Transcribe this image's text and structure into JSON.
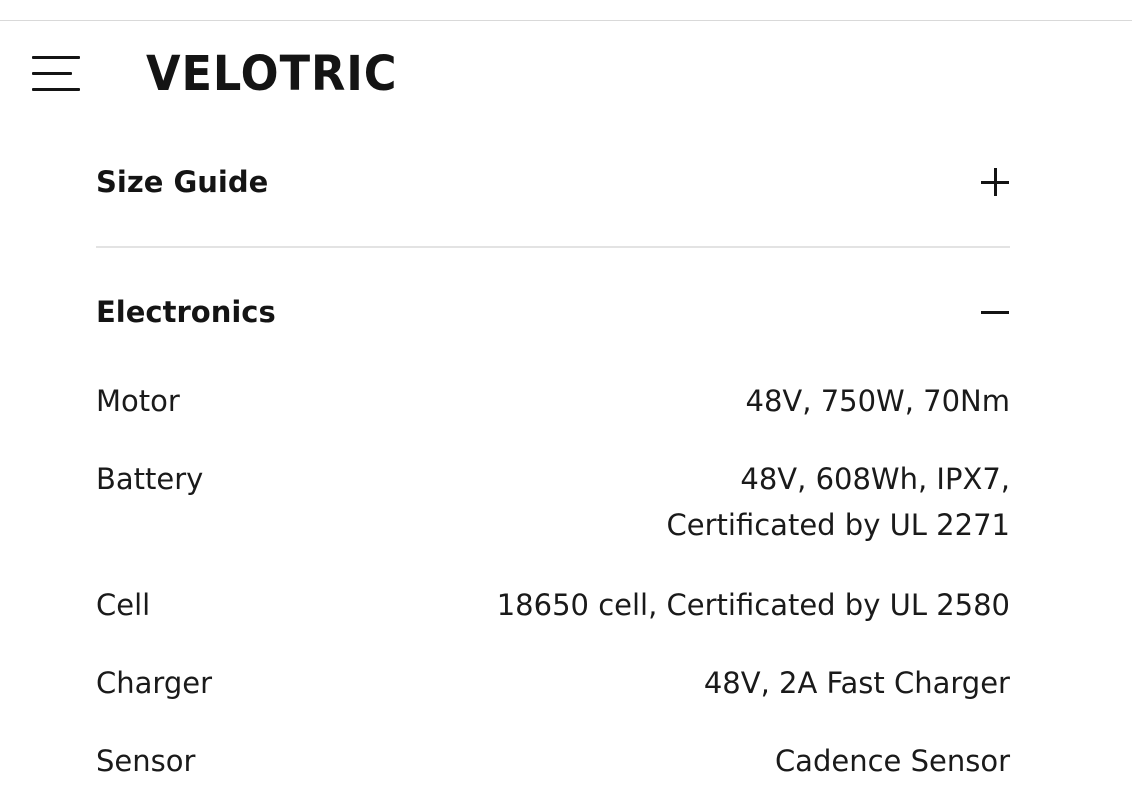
{
  "header": {
    "brand": "VELOTRIC",
    "menu_icon": "hamburger-menu-icon"
  },
  "accordion": [
    {
      "title": "Size Guide",
      "state": "collapsed",
      "icon": "plus-icon"
    },
    {
      "title": "Electronics",
      "state": "expanded",
      "icon": "minus-icon",
      "specs": [
        {
          "label": "Motor",
          "value": "48V, 750W, 70Nm"
        },
        {
          "label": "Battery",
          "value_line1": "48V, 608Wh, IPX7,",
          "value_line2": "Certificated by UL 2271"
        },
        {
          "label": "Cell",
          "value": "18650 cell, Certificated by UL 2580"
        },
        {
          "label": "Charger",
          "value": "48V, 2A Fast Charger"
        },
        {
          "label": "Sensor",
          "value": "Cadence Sensor"
        }
      ]
    }
  ]
}
